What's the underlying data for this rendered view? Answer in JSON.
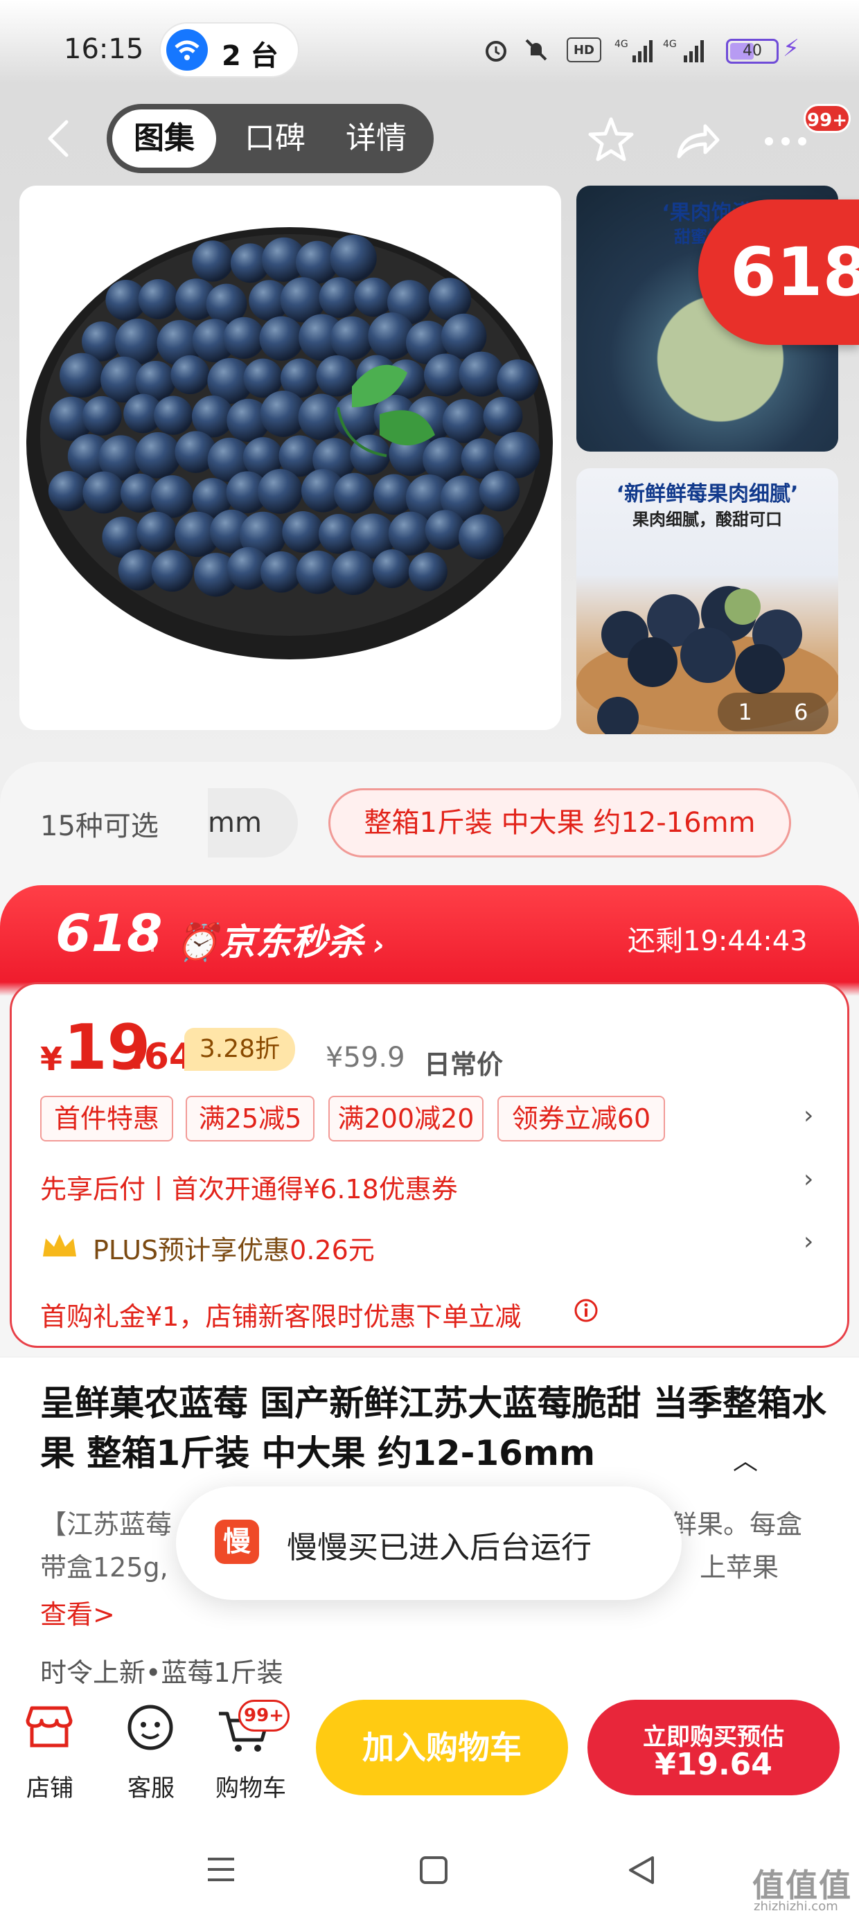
{
  "status_bar": {
    "time": "16:15",
    "device_pill": "2 台",
    "battery": "40",
    "icons": [
      "alarm-icon",
      "mute-icon",
      "hd-icon",
      "signal-4g-icon",
      "signal-4g-icon",
      "battery-icon",
      "charging-icon"
    ]
  },
  "nav": {
    "tabs": [
      {
        "label": "图集",
        "active": true
      },
      {
        "label": "口碑",
        "active": false
      },
      {
        "label": "详情",
        "active": false
      }
    ],
    "badge": "99+",
    "icons": [
      "back-icon",
      "star-icon",
      "share-icon",
      "more-icon"
    ]
  },
  "gallery": {
    "thumb1_line1": "‘果肉饱满",
    "thumb1_line2": "甜蜜爆汁",
    "thumb2_line1": "‘新鲜鲜莓果肉细腻’",
    "thumb2_line2": "果肉细腻，酸甜可口",
    "promo": "618",
    "counter_current": "1",
    "counter_total": "6"
  },
  "options": {
    "label": "15种可选",
    "partial": "mm",
    "selected": "整箱1斤装 中大果 约12-16mm"
  },
  "seckill": {
    "tag": "618",
    "brand": "京东秒杀",
    "countdown": "还剩19:44:43"
  },
  "price": {
    "symbol": "¥",
    "integer": "19",
    "decimal": ".64",
    "discount": "3.28折",
    "original": "¥59.9",
    "original_label": "日常价"
  },
  "coupons": [
    "首件特惠",
    "满25减5",
    "满200减20",
    "领券立减60"
  ],
  "rows": {
    "pay_later": "先享后付丨首次开通得¥6.18优惠券",
    "plus_prefix": "PLUS预计享优惠",
    "plus_value": "0.26元",
    "gift": "首购礼金¥1，店铺新客限时优惠下单立减"
  },
  "product": {
    "title": "呈鲜菓农蓝莓 国产新鲜江苏大蓝莓脆甜 当季整箱水果 整箱1斤装 中大果 约12-16mm",
    "desc_line1_left": "【江苏蓝莓",
    "desc_line1_right": "鲜果。每盒",
    "desc_line2_left": "带盒125g,",
    "desc_line2_right": "上苹果",
    "desc_link": "查看>",
    "season": "时令上新•蓝莓1斤装"
  },
  "toast": {
    "icon_char": "慢",
    "text": "慢慢买已进入后台运行"
  },
  "bottom_bar": {
    "store": "店铺",
    "service": "客服",
    "cart": "购物车",
    "cart_badge": "99+",
    "add_to_cart": "加入购物车",
    "buy_line1": "立即购买预估",
    "buy_line2": "¥19.64"
  },
  "watermark": {
    "big": "值值值",
    "small": "zhizhizhi.com"
  },
  "colors": {
    "accent_red": "#e2231a",
    "cart_yellow": "#ffcb12",
    "buy_red": "#e8263a"
  }
}
